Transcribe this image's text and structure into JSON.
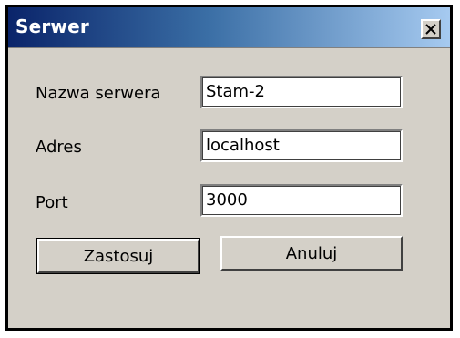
{
  "window": {
    "title": "Serwer",
    "close_icon": "close-icon"
  },
  "form": {
    "server_name": {
      "label": "Nazwa serwera",
      "value": "Stam-2"
    },
    "address": {
      "label": "Adres",
      "value": "localhost"
    },
    "port": {
      "label": "Port",
      "value": "3000"
    }
  },
  "buttons": {
    "apply_label": "Zastosuj",
    "cancel_label": "Anuluj"
  },
  "colors": {
    "titlebar_start": "#0a246a",
    "titlebar_end": "#a6caf0",
    "dialog_background": "#d4d0c8"
  }
}
